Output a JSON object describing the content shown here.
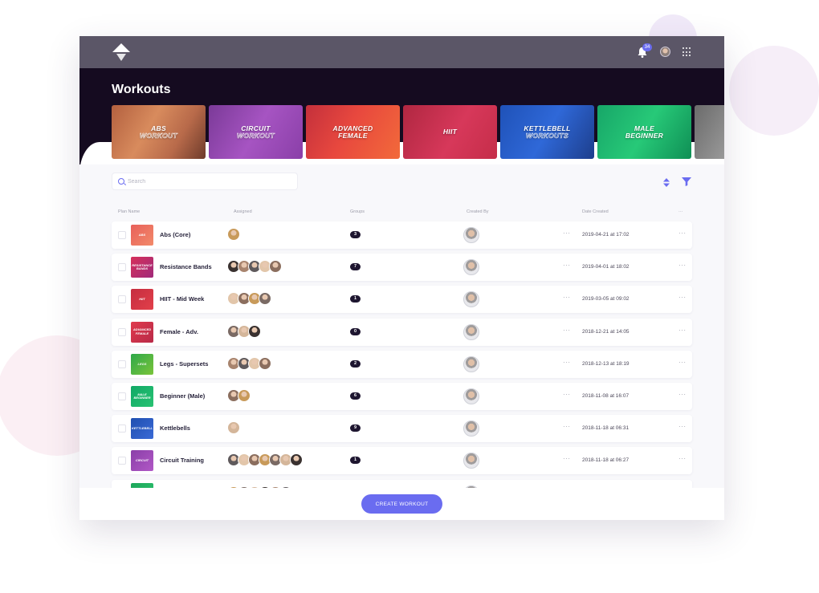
{
  "topbar": {
    "notification_count": "34"
  },
  "page": {
    "title": "Workouts"
  },
  "banners": [
    {
      "label": "ABS",
      "label2": "WORKOUT",
      "outline": true
    },
    {
      "label": "CIRCUIT",
      "label2": "WORKOUT",
      "outline": true
    },
    {
      "label": "ADVANCED",
      "label2": "FEMALE",
      "outline": false
    },
    {
      "label": "HIIT",
      "label2": "",
      "outline": false
    },
    {
      "label": "KETTLEBELL",
      "label2": "WORKOUTS",
      "outline": true
    },
    {
      "label": "MALE",
      "label2": "BEGINNER",
      "outline": false
    },
    {
      "label": "",
      "label2": "",
      "outline": false
    }
  ],
  "search": {
    "placeholder": "Search"
  },
  "columns": {
    "plan_name": "Plan Name",
    "assigned": "Assigned",
    "groups": "Groups",
    "created_by": "Created By",
    "date_created": "Date Created",
    "more": "···"
  },
  "rows": [
    {
      "name": "Abs (Core)",
      "thumb_label": "ABS",
      "groups": "3",
      "date": "2019-04-21 at 17:02",
      "avatars": 1
    },
    {
      "name": "Resistance Bands",
      "thumb_label": "RESISTANCE BANDS",
      "groups": "7",
      "date": "2019-04-01 at 18:02",
      "avatars": 5
    },
    {
      "name": "HIIT - Mid Week",
      "thumb_label": "HIIT",
      "groups": "1",
      "date": "2019-03-05 at 09:02",
      "avatars": 4
    },
    {
      "name": "Female - Adv.",
      "thumb_label": "ADVANCED FEMALE",
      "groups": "0",
      "date": "2018-12-21 at 14:05",
      "avatars": 3
    },
    {
      "name": "Legs - Supersets",
      "thumb_label": "LEGS",
      "groups": "2",
      "date": "2018-12-13 at 18:19",
      "avatars": 4
    },
    {
      "name": "Beginner (Male)",
      "thumb_label": "MALE BEGINNER",
      "groups": "6",
      "date": "2018-11-08 at 16:07",
      "avatars": 2
    },
    {
      "name": "Kettlebells",
      "thumb_label": "KETTLEBELL",
      "groups": "9",
      "date": "2018-11-18 at 06:31",
      "avatars": 1
    },
    {
      "name": "Circuit Training",
      "thumb_label": "CIRCUIT",
      "groups": "1",
      "date": "2018-11-18 at 06:27",
      "avatars": 7
    },
    {
      "name": "",
      "thumb_label": "",
      "groups": "",
      "date": "",
      "avatars": 6
    }
  ],
  "row_more": "···",
  "footer": {
    "create_label": "CREATE WORKOUT"
  },
  "colors": {
    "accent": "#6a6cf0",
    "topbar": "#5b5667",
    "hero": "#150b20",
    "group_badge": "#1e1630"
  }
}
